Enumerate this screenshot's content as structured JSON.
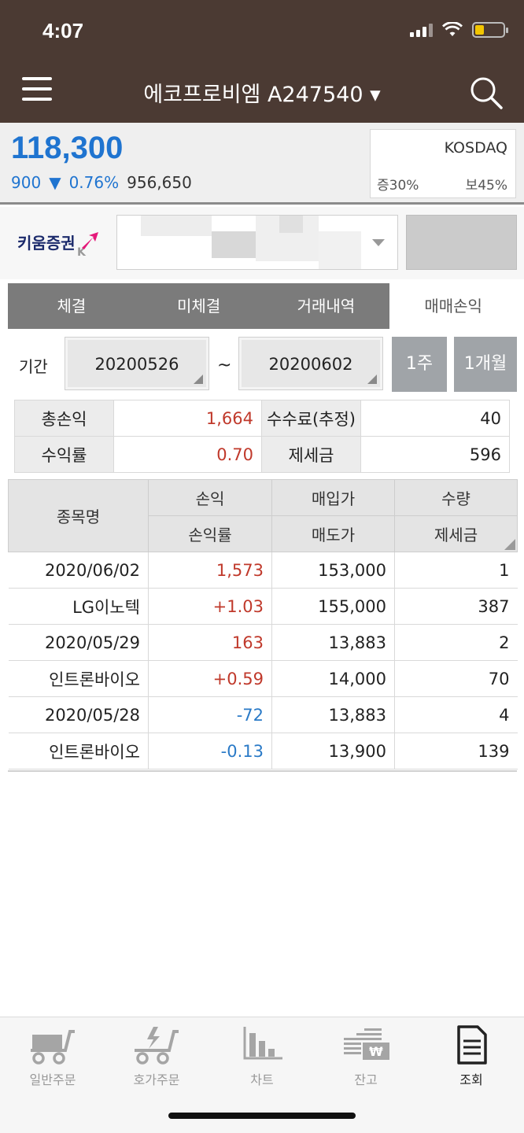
{
  "status_bar": {
    "time": "4:07"
  },
  "header": {
    "title": "에코프로비엠 A247540 ▾"
  },
  "quote": {
    "price": "118,300",
    "change": "900",
    "direction_symbol": "▼",
    "change_pct": "0.76%",
    "volume": "956,650",
    "market": "KOSDAQ",
    "margin_left": "증30%",
    "margin_right": "보45%"
  },
  "account": {
    "broker_logo_text": "키움증권",
    "broker_logo_k": "K"
  },
  "tabs": [
    {
      "label": "체결",
      "active": false
    },
    {
      "label": "미체결",
      "active": false
    },
    {
      "label": "거래내역",
      "active": false
    },
    {
      "label": "매매손익",
      "active": true
    }
  ],
  "period": {
    "label": "기간",
    "start": "20200526",
    "separator": "~",
    "end": "20200602",
    "btn_week": "1주",
    "btn_month": "1개월"
  },
  "summary": {
    "total_pl_label": "총손익",
    "total_pl": "1,664",
    "fee_label": "수수료(추정)",
    "fee": "40",
    "return_label": "수익률",
    "return": "0.70",
    "tax_label": "제세금",
    "tax": "596"
  },
  "table": {
    "headers": {
      "name": "종목명",
      "pl": "손익",
      "pl_rate": "손익률",
      "buy_price": "매입가",
      "sell_price": "매도가",
      "qty": "수량",
      "tax": "제세금"
    },
    "rows": [
      {
        "c1": "2020/06/02",
        "c2": "1,573",
        "c2_color": "red",
        "c3": "153,000",
        "c4": "1"
      },
      {
        "c1": "LG이노텍",
        "c2": "+1.03",
        "c2_color": "red",
        "c3": "155,000",
        "c4": "387"
      },
      {
        "c1": "2020/05/29",
        "c2": "163",
        "c2_color": "red",
        "c3": "13,883",
        "c4": "2"
      },
      {
        "c1": "인트론바이오",
        "c2": "+0.59",
        "c2_color": "red",
        "c3": "14,000",
        "c4": "70"
      },
      {
        "c1": "2020/05/28",
        "c2": "-72",
        "c2_color": "blue",
        "c3": "13,883",
        "c4": "4"
      },
      {
        "c1": "인트론바이오",
        "c2": "-0.13",
        "c2_color": "blue",
        "c3": "13,900",
        "c4": "139"
      }
    ]
  },
  "bottom_nav": [
    {
      "label": "일반주문",
      "icon": "cart-icon"
    },
    {
      "label": "호가주문",
      "icon": "cart-bolt-icon"
    },
    {
      "label": "차트",
      "icon": "bar-chart-icon"
    },
    {
      "label": "잔고",
      "icon": "balance-won-icon"
    },
    {
      "label": "조회",
      "icon": "document-icon"
    }
  ],
  "colors": {
    "header_bg": "#4b3a33",
    "price_blue": "#1f74d0",
    "profit_red": "#c0392b",
    "loss_blue": "#2a7ac7"
  }
}
